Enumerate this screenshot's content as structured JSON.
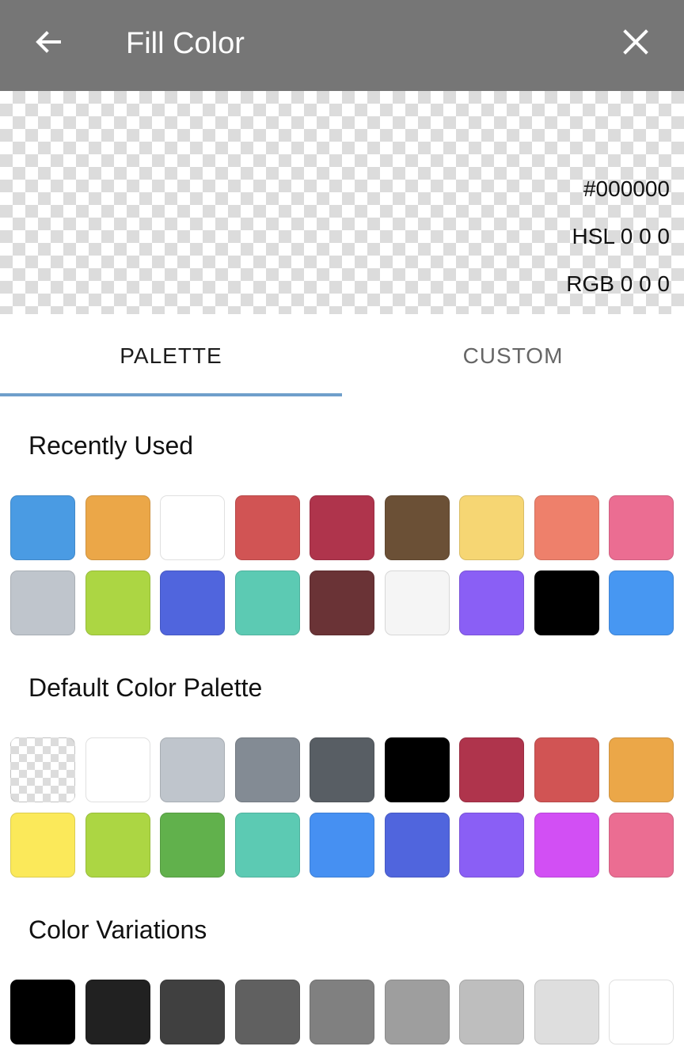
{
  "header": {
    "title": "Fill Color",
    "back_icon": "arrow-left-icon",
    "close_icon": "close-icon",
    "background": "#767676"
  },
  "preview": {
    "hex": "#000000",
    "hsl": "HSL 0 0 0",
    "rgb": "RGB 0 0 0"
  },
  "tabs": [
    {
      "label": "PALETTE",
      "active": true
    },
    {
      "label": "CUSTOM",
      "active": false
    }
  ],
  "accent": "#6f9fcb",
  "sections": {
    "recent": {
      "title": "Recently Used",
      "colors": [
        "#4a9be3",
        "#eba748",
        "#ffffff",
        "#d15454",
        "#af344c",
        "#6b5036",
        "#f6d673",
        "#ee806b",
        "#eb6d92",
        "#bfc5cc",
        "#acd643",
        "#5065dd",
        "#5ccab3",
        "#6a3336",
        "#f5f5f5",
        "#8a5ff5",
        "#000000",
        "#4797f2"
      ]
    },
    "default": {
      "title": "Default Color Palette",
      "colors": [
        "transparent",
        "#ffffff",
        "#bfc5cc",
        "#838b94",
        "#585e64",
        "#000000",
        "#af344c",
        "#d15454",
        "#eba748",
        "#fbe95a",
        "#acd643",
        "#61b14c",
        "#5ccab3",
        "#4690f2",
        "#5065dd",
        "#8a5ff5",
        "#d24ff4",
        "#eb6d92"
      ]
    },
    "variations": {
      "title": "Color Variations",
      "colors": [
        "#000000",
        "#212121",
        "#404040",
        "#606060",
        "#808080",
        "#9e9e9e",
        "#bebebe",
        "#dedede",
        "#ffffff"
      ]
    }
  }
}
